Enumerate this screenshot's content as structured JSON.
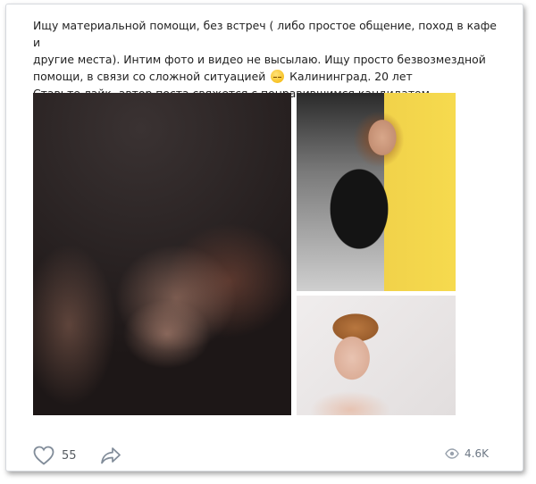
{
  "post": {
    "text_lines": [
      "Ищу материальной помощи, без встреч ( либо простое общение, поход в кафе и",
      "другие места). Интим фото и видео не высылаю. Ищу просто безвозмездной",
      "помощи, в связи со сложной ситуацией",
      "Калининград. 20 лет",
      "Ставьте лайк, автор поста свяжется с понравившимся кандидатом."
    ],
    "emoji": "😔"
  },
  "actions": {
    "like_count": "55",
    "views_count": "4.6K"
  },
  "colors": {
    "icon": "#818c99",
    "text": "#222222"
  }
}
